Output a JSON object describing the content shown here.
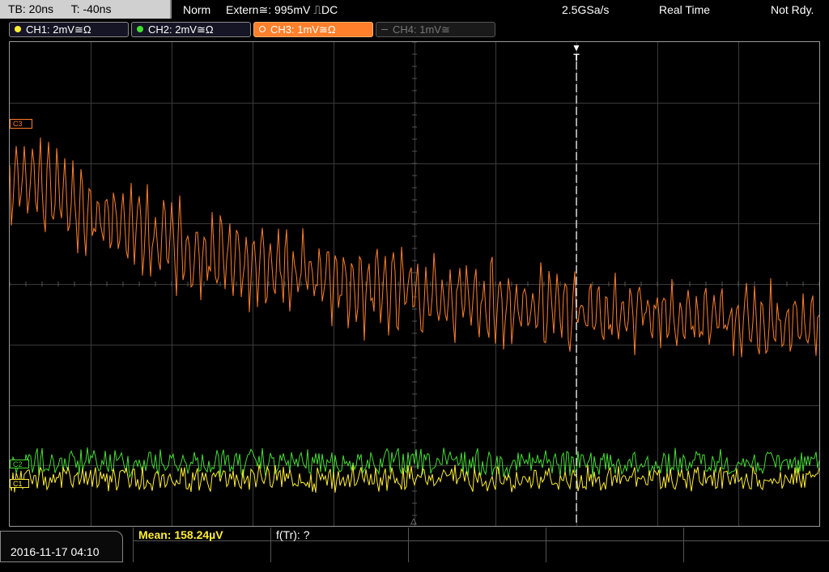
{
  "header": {
    "timebase": "TB: 20ns",
    "trigger_time": "T: -40ns",
    "trigger_mode": "Norm",
    "trigger_source": "Extern≅: 995mV ⎍DC",
    "sample_rate": "2.5GSa/s",
    "acq_mode": "Real Time",
    "status": "Not Rdy."
  },
  "channels": [
    {
      "label": "CH1: 2mV≅Ω",
      "color": "#ffee33",
      "state": "on"
    },
    {
      "label": "CH2: 2mV≅Ω",
      "color": "#44dd33",
      "state": "on"
    },
    {
      "label": "CH3: 1mV≅Ω",
      "color": "#ff7f2a",
      "state": "active"
    },
    {
      "label": "CH4: 1mV≅",
      "color": "#777777",
      "state": "off"
    }
  ],
  "markers": {
    "ch3": "C3",
    "ch2": "C2",
    "ch1": "C1",
    "trigger": "T"
  },
  "footer": {
    "datetime": "2016-11-17 04:10",
    "measurement1": "Mean: 158.24µV",
    "measurement2": "f(Tr): ?"
  },
  "colors": {
    "ch1": "#ffee33",
    "ch2": "#44dd33",
    "ch3": "#ff7f2a",
    "grid": "#3a3a3a",
    "accent": "#ff7f2a"
  }
}
